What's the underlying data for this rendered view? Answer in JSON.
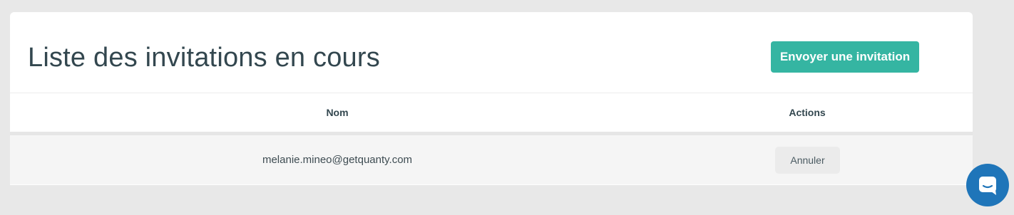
{
  "header": {
    "title": "Liste des invitations en cours",
    "invite_button_label": "Envoyer une invitation"
  },
  "table": {
    "columns": [
      "Nom",
      "Actions"
    ],
    "rows": [
      {
        "email": "melanie.mineo@getquanty.com",
        "action_label": "Annuler"
      }
    ]
  },
  "chat": {
    "icon": "chat-bubble-icon"
  },
  "colors": {
    "accent": "#35b5a2",
    "title_text": "#33474f",
    "chat_launcher": "#1f75b9",
    "background": "#e8e8e8"
  }
}
